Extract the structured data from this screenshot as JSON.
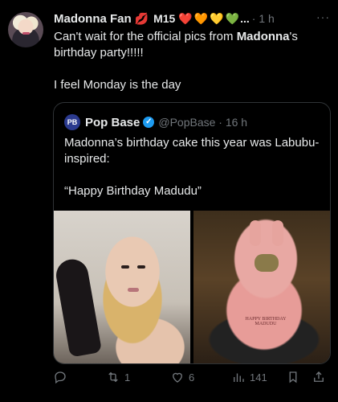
{
  "tweet": {
    "author_name": "Madonna Fan",
    "author_tag": "M15",
    "hearts": [
      "❤️",
      "🧡",
      "💛",
      "💚"
    ],
    "ellipsis": "...",
    "time": "· 1 h",
    "more": "···",
    "line1_pre": "Can't wait for the official pics from ",
    "line1_bold": "Madonna",
    "line1_post": "'s birthday party!!!!!",
    "line2": "I feel Monday is the day"
  },
  "quote": {
    "name": "Pop Base",
    "handle": "@PopBase · 16 h",
    "text1": "Madonna’s birthday cake this year was Labubu-inspired:",
    "text2": "“Happy Birthday Madudu”",
    "cake_label": "HAPPY BIRTHDAY MADUDU"
  },
  "actions": {
    "retweets": "1",
    "likes": "6",
    "views": "141"
  }
}
